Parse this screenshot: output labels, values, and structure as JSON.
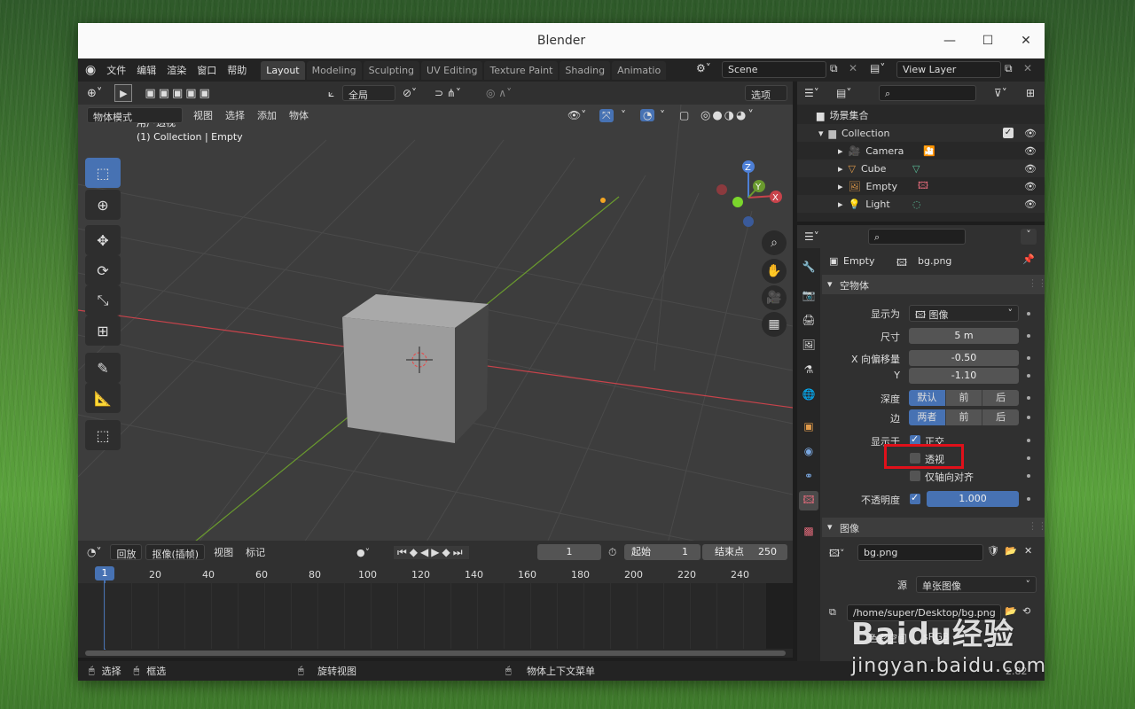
{
  "window": {
    "title": "Blender"
  },
  "menu": [
    "文件",
    "编辑",
    "渲染",
    "窗口",
    "帮助"
  ],
  "workspaces": [
    "Layout",
    "Modeling",
    "Sculpting",
    "UV Editing",
    "Texture Paint",
    "Shading",
    "Animatio"
  ],
  "scene": "Scene",
  "view_layer": "View Layer",
  "viewport": {
    "orientation": "全局",
    "options_label": "选项",
    "mode": "物体模式",
    "menus": [
      "视图",
      "选择",
      "添加",
      "物体"
    ],
    "overlay_title": "用户透视",
    "overlay_sub": "(1) Collection | Empty",
    "gizmo": {
      "z": "Z",
      "y": "Y",
      "x": "X"
    }
  },
  "outliner": {
    "root": "场景集合",
    "collection": "Collection",
    "items": [
      "Camera",
      "Cube",
      "Empty",
      "Light"
    ]
  },
  "properties": {
    "breadcrumb_object": "Empty",
    "breadcrumb_image": "bg.png",
    "panel_empty": "空物体",
    "display_as_label": "显示为",
    "display_as_value": "图像",
    "size_label": "尺寸",
    "size_value": "5 m",
    "offset_x_label": "X 向偏移量",
    "offset_x_value": "-0.50",
    "offset_y_label": "Y",
    "offset_y_value": "-1.10",
    "depth_label": "深度",
    "depth_options": [
      "默认",
      "前",
      "后"
    ],
    "side_label": "边",
    "side_options": [
      "两者",
      "前",
      "后"
    ],
    "show_in_label": "显示于",
    "show_ortho": "正交",
    "show_persp": "透视",
    "show_axis": "仅轴向对齐",
    "opacity_label": "不透明度",
    "opacity_value": "1.000",
    "panel_image": "图像",
    "image_name": "bg.png",
    "source_label": "源",
    "source_value": "单张图像",
    "filepath": "/home/super/Desktop/bg.png",
    "colorspace_label": "色彩空间",
    "colorspace_value": "sRGB"
  },
  "timeline": {
    "playback": "回放",
    "keying": "抠像(插帧)",
    "view": "视图",
    "marker": "标记",
    "frame": "1",
    "start_label": "起始",
    "start": "1",
    "end_label": "结束点",
    "end": "250",
    "current": "1",
    "ticks": [
      "20",
      "40",
      "60",
      "80",
      "100",
      "120",
      "140",
      "160",
      "180",
      "200",
      "220",
      "240"
    ]
  },
  "status": {
    "select": "选择",
    "box": "框选",
    "rotate": "旋转视图",
    "context": "物体上下文菜单",
    "version": "2.82"
  },
  "watermark": {
    "brand": "Baidu经验",
    "url": "jingyan.baidu.com"
  },
  "colors": {
    "accent": "#4772b3",
    "highlight_box": "#e0101a",
    "x_axis": "#c8434b",
    "y_axis": "#6a9a2e"
  }
}
